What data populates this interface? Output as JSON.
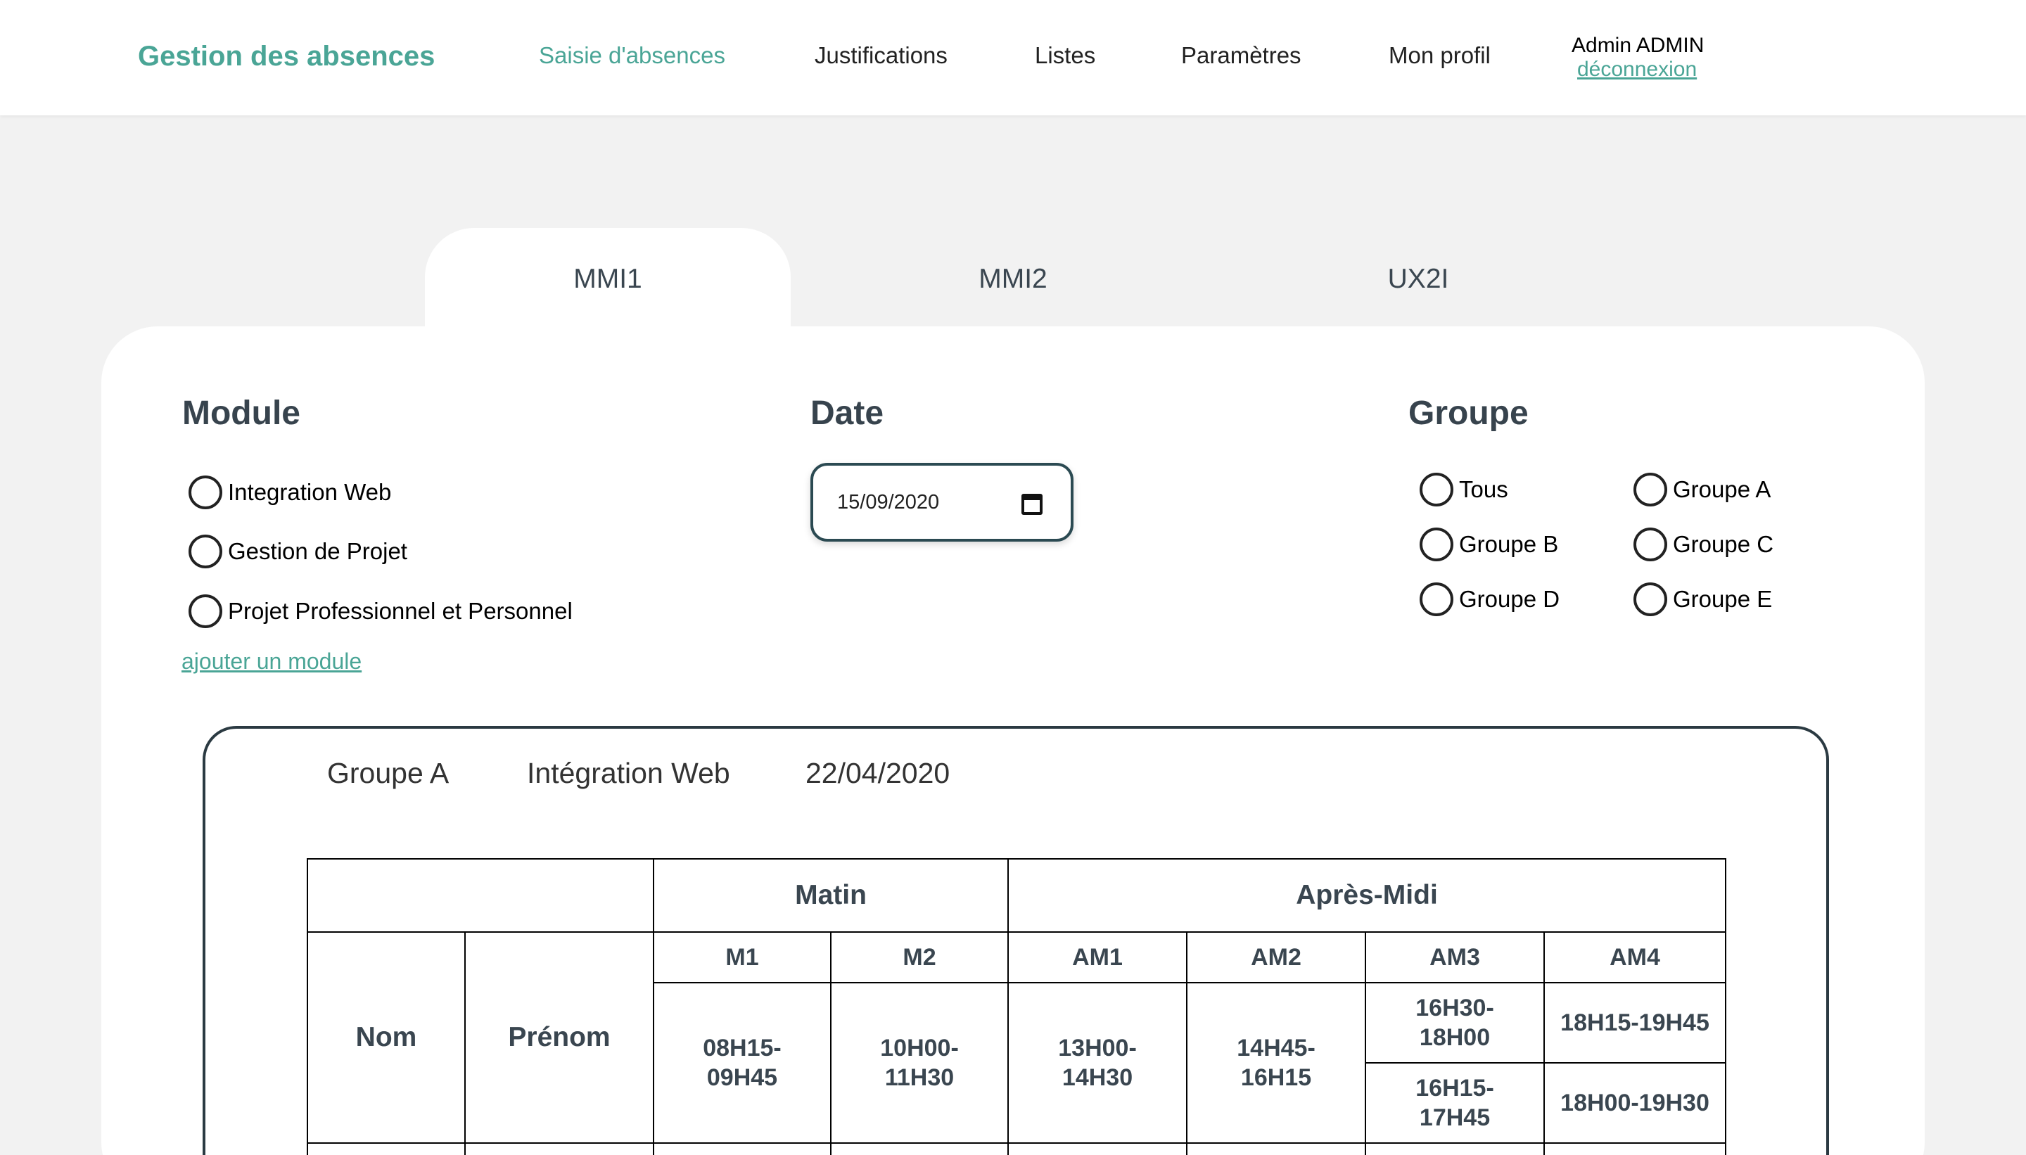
{
  "header": {
    "brand": "Gestion des absences",
    "nav": [
      {
        "label": "Saisie d'absences",
        "active": true
      },
      {
        "label": "Justifications",
        "active": false
      },
      {
        "label": "Listes",
        "active": false
      },
      {
        "label": "Paramètres",
        "active": false
      },
      {
        "label": "Mon profil",
        "active": false
      }
    ],
    "user_name": "Admin ADMIN",
    "logout_label": "déconnexion"
  },
  "tabs": [
    {
      "label": "MMI1",
      "active": true
    },
    {
      "label": "MMI2",
      "active": false
    },
    {
      "label": "UX2I",
      "active": false
    }
  ],
  "module": {
    "title": "Module",
    "options": [
      "Integration Web",
      "Gestion de Projet",
      "Projet Professionnel et Personnel"
    ],
    "add_label": "ajouter un module"
  },
  "date": {
    "title": "Date",
    "value": "15/09/2020"
  },
  "groupe": {
    "title": "Groupe",
    "options": [
      "Tous",
      "Groupe A",
      "Groupe B",
      "Groupe C",
      "Groupe D",
      "Groupe E"
    ]
  },
  "summary": {
    "group": "Groupe A",
    "module": "Intégration Web",
    "date": "22/04/2020"
  },
  "table": {
    "matin": "Matin",
    "apres_midi": "Après-Midi",
    "nom": "Nom",
    "prenom": "Prénom",
    "slots": {
      "m1": "M1",
      "m2": "M2",
      "am1": "AM1",
      "am2": "AM2",
      "am3": "AM3",
      "am4": "AM4"
    },
    "times": {
      "m1_a": "08H15-",
      "m1_b": "09H45",
      "m2_a": "10H00-",
      "m2_b": "11H30",
      "am1_a": "13H00-",
      "am1_b": "14H30",
      "am2_a": "14H45-",
      "am2_b": "16H15",
      "am3_1a": "16H30-",
      "am3_1b": "18H00",
      "am3_2a": "16H15-",
      "am3_2b": "17H45",
      "am4_1": "18H15-19H45",
      "am4_2": "18H00-19H30"
    }
  },
  "colors": {
    "accent": "#4aa596",
    "background": "#f2f2f2",
    "heading": "#37434d"
  }
}
